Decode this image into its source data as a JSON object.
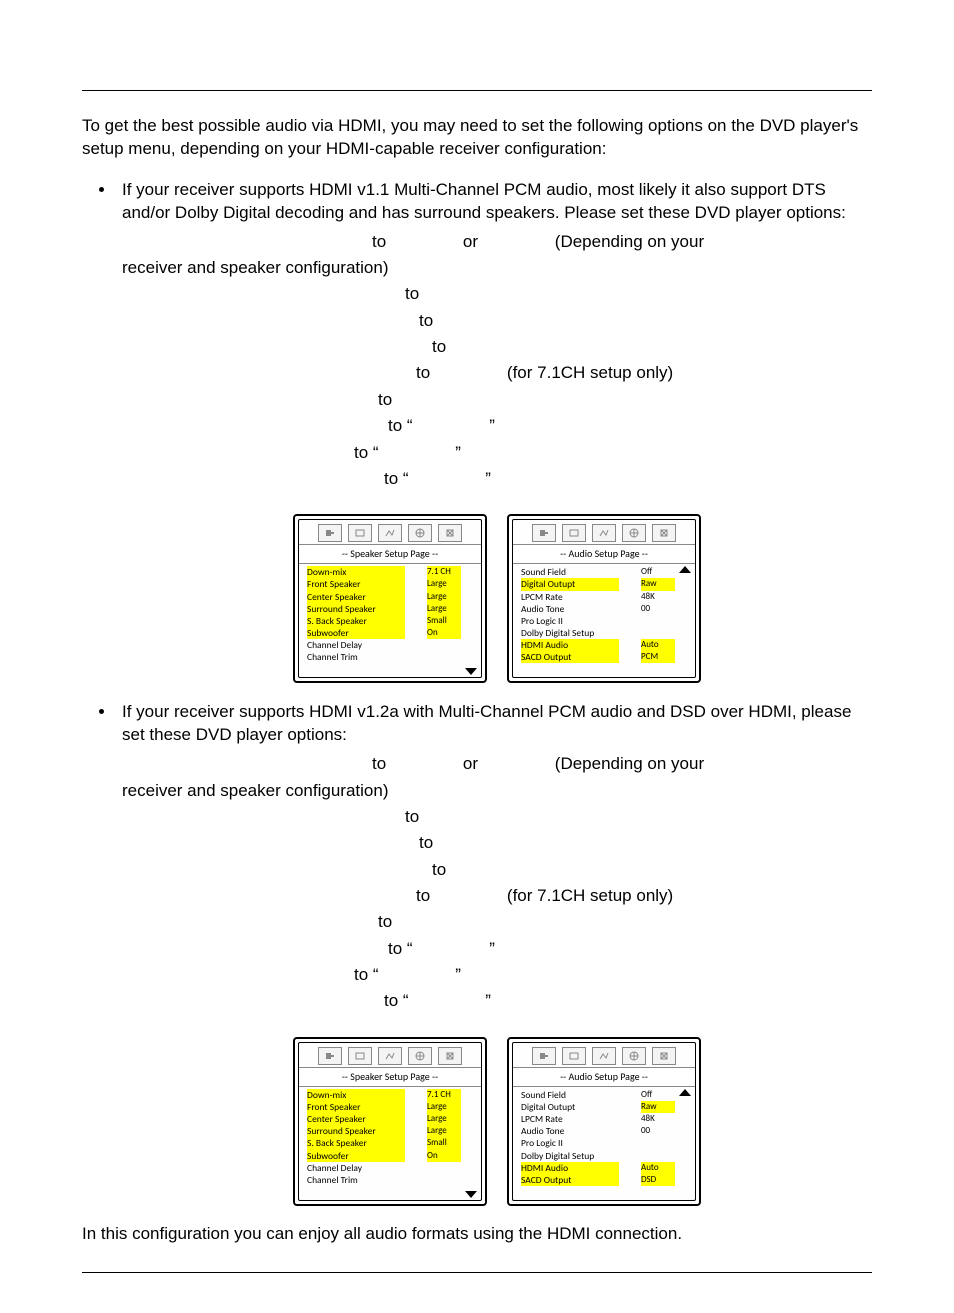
{
  "intro": "To get the best possible audio via HDMI, you may need to set the following options on the DVD player's setup menu, depending on your HDMI-capable receiver configuration:",
  "bullets": [
    {
      "lead": "If your receiver supports HDMI v1.1 Multi-Channel PCM audio, most likely it also support DTS and/or Dolby Digital decoding and has surround speakers.  Please set these DVD player options:",
      "lines": [
        {
          "pad": 250,
          "a": "to",
          "b": "or",
          "c": "(Depending on your"
        },
        {
          "pad": 0,
          "a": "receiver and speaker configuration)"
        },
        {
          "pad": 283,
          "a": "to"
        },
        {
          "pad": 297,
          "a": "to"
        },
        {
          "pad": 310,
          "a": "to"
        },
        {
          "pad": 294,
          "a": "to",
          "c": "(for 7.1CH setup only)"
        },
        {
          "pad": 256,
          "a": "to"
        },
        {
          "pad": 266,
          "a": "to “",
          "b": "”"
        },
        {
          "pad": 232,
          "a": "to “",
          "b": "”"
        },
        {
          "pad": 262,
          "a": "to “",
          "b": "”"
        }
      ],
      "speaker_panel": {
        "title": "-- Speaker Setup Page --",
        "rows": [
          {
            "k": "Down-mix",
            "v": "7.1 CH",
            "hl": true
          },
          {
            "k": "Front Speaker",
            "v": "Large",
            "hl": true
          },
          {
            "k": "Center Speaker",
            "v": "Large",
            "hl": true
          },
          {
            "k": "Surround Speaker",
            "v": "Large",
            "hl": true
          },
          {
            "k": "S. Back Speaker",
            "v": "Small",
            "hl": true
          },
          {
            "k": "Subwoofer",
            "v": "On",
            "hl": true
          },
          {
            "k": "Channel Delay",
            "v": ""
          },
          {
            "k": "Channel Trim",
            "v": ""
          }
        ]
      },
      "audio_panel": {
        "title": "-- Audio Setup Page --",
        "rows": [
          {
            "k": "Sound Field",
            "v": "Off"
          },
          {
            "k": "Digital Outupt",
            "v": "Raw",
            "hl": true
          },
          {
            "k": "LPCM Rate",
            "v": "48K"
          },
          {
            "k": "Audio Tone",
            "v": "00"
          },
          {
            "k": "Pro Logic II",
            "v": ""
          },
          {
            "k": "Dolby Digital Setup",
            "v": ""
          },
          {
            "k": "HDMI Audio",
            "v": "Auto",
            "hl": true
          },
          {
            "k": "SACD Output",
            "v": "PCM",
            "hl": true
          }
        ]
      }
    },
    {
      "lead": "If your receiver supports HDMI v1.2a with Multi-Channel PCM audio and DSD over HDMI, please set these DVD player options:",
      "lines": [
        {
          "pad": 250,
          "a": "to",
          "b": "or",
          "c": "(Depending on your"
        },
        {
          "pad": 0,
          "a": "receiver and speaker configuration)"
        },
        {
          "pad": 283,
          "a": "to"
        },
        {
          "pad": 297,
          "a": "to"
        },
        {
          "pad": 310,
          "a": "to"
        },
        {
          "pad": 294,
          "a": "to",
          "c": "(for 7.1CH setup only)"
        },
        {
          "pad": 256,
          "a": "to"
        },
        {
          "pad": 266,
          "a": "to “",
          "b": "”"
        },
        {
          "pad": 232,
          "a": "to “",
          "b": "”"
        },
        {
          "pad": 262,
          "a": "to “",
          "b": "”"
        }
      ],
      "speaker_panel": {
        "title": "-- Speaker Setup Page --",
        "rows": [
          {
            "k": "Down-mix",
            "v": "7.1 CH",
            "hl": true
          },
          {
            "k": "Front Speaker",
            "v": "Large",
            "hl": true
          },
          {
            "k": "Center Speaker",
            "v": "Large",
            "hl": true
          },
          {
            "k": "Surround Speaker",
            "v": "Large",
            "hl": true
          },
          {
            "k": "S. Back Speaker",
            "v": "Small",
            "hl": true
          },
          {
            "k": "Subwoofer",
            "v": "On",
            "hl": true
          },
          {
            "k": "Channel Delay",
            "v": ""
          },
          {
            "k": "Channel Trim",
            "v": ""
          }
        ]
      },
      "audio_panel": {
        "title": "-- Audio Setup Page --",
        "rows": [
          {
            "k": "Sound Field",
            "v": "Off"
          },
          {
            "k": "Digital Outupt",
            "v": "Raw",
            "hlv": true
          },
          {
            "k": "LPCM Rate",
            "v": "48K"
          },
          {
            "k": "Audio Tone",
            "v": "00"
          },
          {
            "k": "Pro Logic II",
            "v": ""
          },
          {
            "k": "Dolby Digital Setup",
            "v": ""
          },
          {
            "k": "HDMI Audio",
            "v": "Auto",
            "hl": true
          },
          {
            "k": "SACD Output",
            "v": "DSD",
            "hl": true
          }
        ]
      }
    }
  ],
  "tail": "In this configuration you can enjoy all audio formats using the HDMI connection.",
  "tab_icons": [
    "speaker-icon",
    "video-icon",
    "audio-icon",
    "globe-icon",
    "misc-icon"
  ]
}
